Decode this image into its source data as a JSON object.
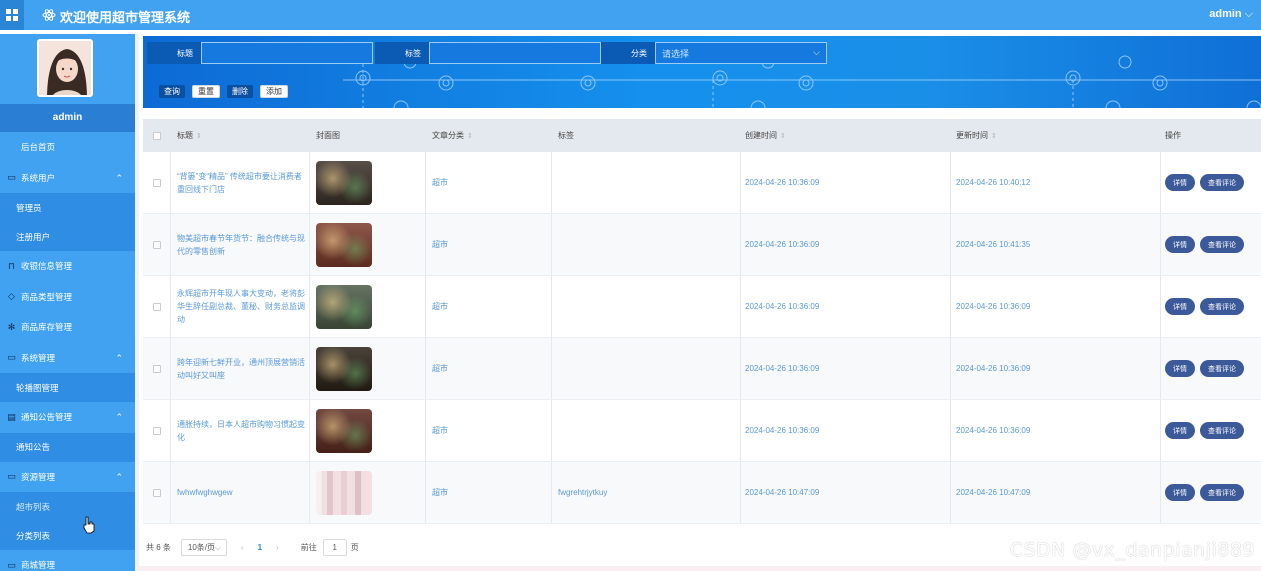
{
  "header": {
    "app_title": "欢迎使用超市管理系统",
    "user": "admin"
  },
  "sidebar": {
    "username": "admin",
    "items": [
      {
        "label": "后台首页",
        "icon": "home-icon"
      },
      {
        "label": "系统用户",
        "icon": "monitor-icon",
        "expanded": true
      },
      {
        "label": "管理员"
      },
      {
        "label": "注册用户"
      },
      {
        "label": "收银信息管理",
        "icon": "bookmark-icon"
      },
      {
        "label": "商品类型管理",
        "icon": "tag-icon"
      },
      {
        "label": "商品库存管理",
        "icon": "gear-icon"
      },
      {
        "label": "系统管理",
        "icon": "monitor-icon",
        "expanded": true
      },
      {
        "label": "轮播图管理"
      },
      {
        "label": "通知公告管理",
        "icon": "clipboard-icon",
        "expanded": true
      },
      {
        "label": "通知公告"
      },
      {
        "label": "资源管理",
        "icon": "chat-icon",
        "expanded": true
      },
      {
        "label": "超市列表"
      },
      {
        "label": "分类列表"
      },
      {
        "label": "商城管理",
        "icon": "monitor-icon"
      }
    ]
  },
  "search": {
    "title_label": "标题",
    "tag_label": "标签",
    "category_label": "分类",
    "category_placeholder": "请选择"
  },
  "buttons": {
    "query": "查询",
    "reset": "重置",
    "delete": "删除",
    "add": "添加"
  },
  "table": {
    "headers": [
      "标题",
      "封面图",
      "文章分类",
      "标签",
      "创建时间",
      "更新时间",
      "操作"
    ],
    "rows": [
      {
        "title": "“背篓”变“精品” 传统超市要让消费者重回线下门店",
        "category": "超市",
        "tag": "",
        "created": "2024-04-26 10:36:09",
        "updated": "2024-04-26 10:40:12",
        "cover_color": "#3a3028"
      },
      {
        "title": "物美超市春节年货节：融合传统与现代的零售创新",
        "category": "超市",
        "tag": "",
        "created": "2024-04-26 10:36:09",
        "updated": "2024-04-26 10:41:35",
        "cover_color": "#7a3a2a"
      },
      {
        "title": "永辉超市开年现人事大变动，老将彭华生辞任副总裁、董秘、财务总监调动",
        "category": "超市",
        "tag": "",
        "created": "2024-04-26 10:36:09",
        "updated": "2024-04-26 10:36:09",
        "cover_color": "#4b5a46"
      },
      {
        "title": "跨年迎新七鲜开业，通州顶展营销活动叫好又叫座",
        "category": "超市",
        "tag": "",
        "created": "2024-04-26 10:36:09",
        "updated": "2024-04-26 10:36:09",
        "cover_color": "#2b2218"
      },
      {
        "title": "通胀持续，日本人超市购物习惯起变化",
        "category": "超市",
        "tag": "",
        "created": "2024-04-26 10:36:09",
        "updated": "2024-04-26 10:36:09",
        "cover_color": "#5a2a20"
      },
      {
        "title": "fwhwfwghwgew",
        "category": "超市",
        "tag": "fwgrehtrjytkuy",
        "created": "2024-04-26 10:47:09",
        "updated": "2024-04-26 10:47:09",
        "cover_color": "#f1dfe2"
      }
    ],
    "action_detail": "详情",
    "action_comment": "查看评论"
  },
  "pager": {
    "total": "共 6 条",
    "page_size": "10条/页",
    "prev": "‹",
    "current": "1",
    "next": "›",
    "goto_label": "前往",
    "goto_value": "1",
    "goto_unit": "页"
  },
  "watermark": "CSDN @vx_danpianji889"
}
